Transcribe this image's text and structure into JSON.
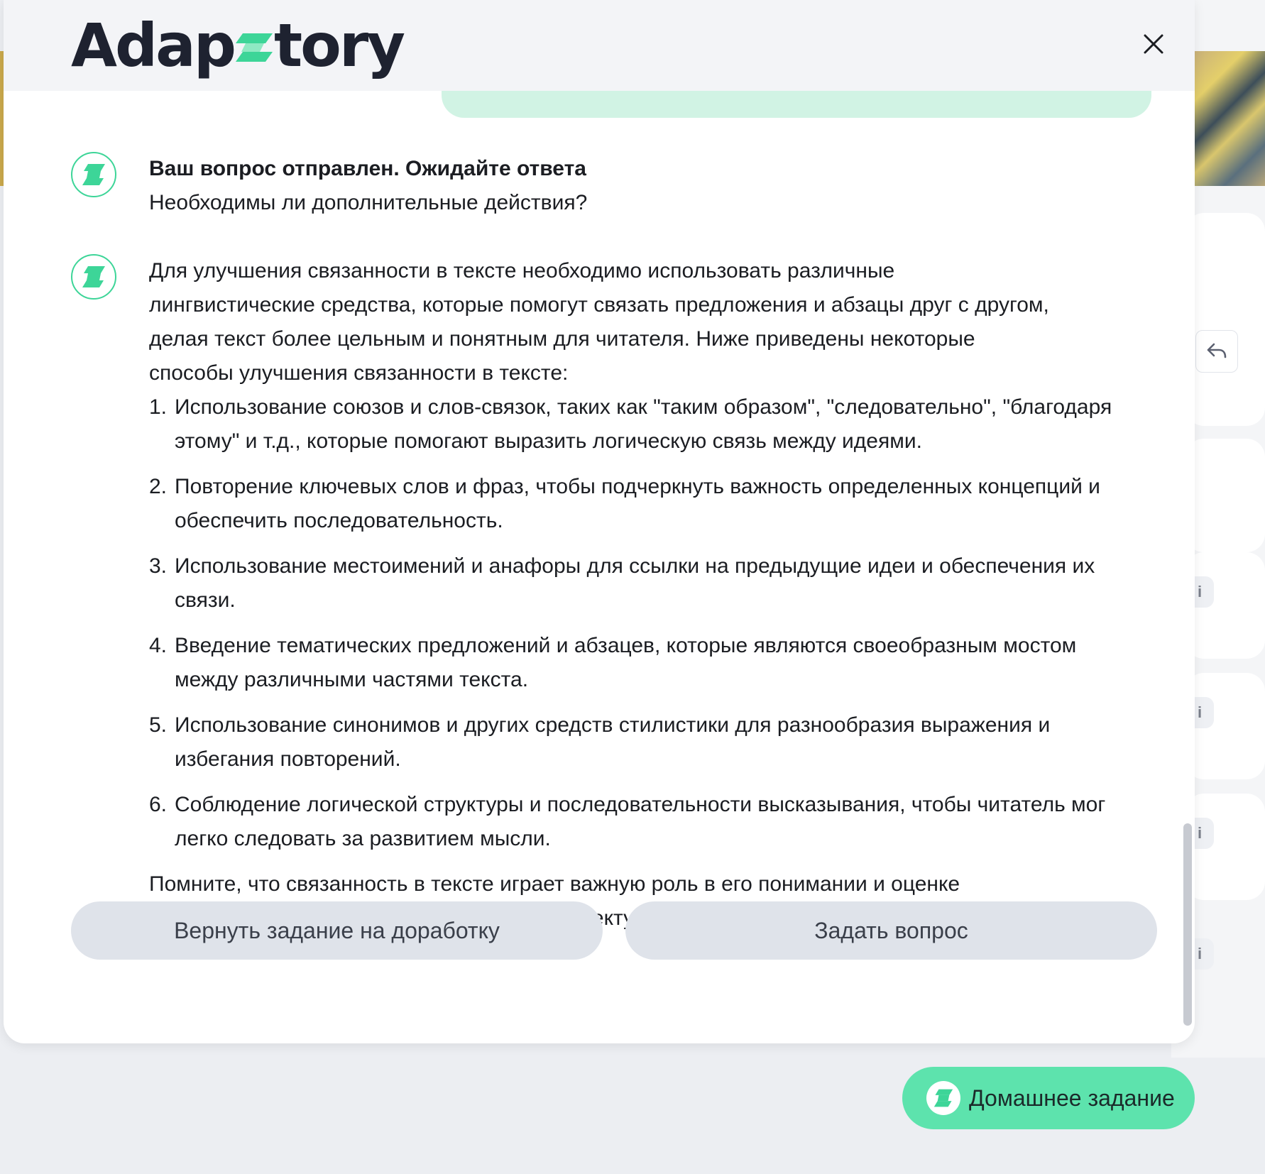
{
  "header": {
    "logo_text_left": "Adap",
    "logo_text_right": "tory"
  },
  "messages": [
    {
      "title": "Ваш вопрос отправлен. Ожидайте ответа",
      "subtitle": "Необходимы ли дополнительные действия?"
    },
    {
      "intro": "Для улучшения связанности в тексте необходимо использовать различные лингвистические средства, которые помогут связать предложения и абзацы друг с другом, делая текст более цельным и понятным для читателя. Ниже приведены некоторые способы улучшения связанности в тексте:",
      "points": [
        {
          "num": "1.",
          "text": "Использование союзов и слов-связок, таких как \"таким образом\", \"следовательно\", \"благодаря этому\" и т.д., которые помогают выразить логическую связь между идеями."
        },
        {
          "num": "2.",
          "text": "Повторение ключевых слов и фраз, чтобы подчеркнуть важность определенных концепций и обеспечить последовательность."
        },
        {
          "num": "3.",
          "text": "Использование местоимений и анафоры для ссылки на предыдущие идеи и обеспечения их связи."
        },
        {
          "num": "4.",
          "text": "Введение тематических предложений и абзацев, которые являются своеобразным мостом между различными частями текста."
        },
        {
          "num": "5.",
          "text": "Использование синонимов и других средств стилистики для разнообразия выражения и избегания повторений."
        },
        {
          "num": "6.",
          "text": "Соблюдение логической структуры и последовательности высказывания, чтобы читатель мог легко следовать за развитием мысли."
        }
      ],
      "outro": "Помните, что связанность в тексте играет важную роль в его понимании и оценке читателем, поэтому стоит уделять этому аспекту особое внимание при написании текстов."
    }
  ],
  "actions": {
    "return_label": "Вернуть задание на доработку",
    "ask_label": "Задать вопрос"
  },
  "homework_button": {
    "label": "Домашнее задание"
  },
  "background": {
    "info_glyph": "i"
  },
  "colors": {
    "accent": "#3dd598",
    "accent_fill": "#5de3ad",
    "bubble": "#d1f3e4",
    "button_gray": "#dfe3ea"
  },
  "icons": [
    "close-icon",
    "brand-s-icon",
    "reply-icon",
    "info-icon"
  ]
}
